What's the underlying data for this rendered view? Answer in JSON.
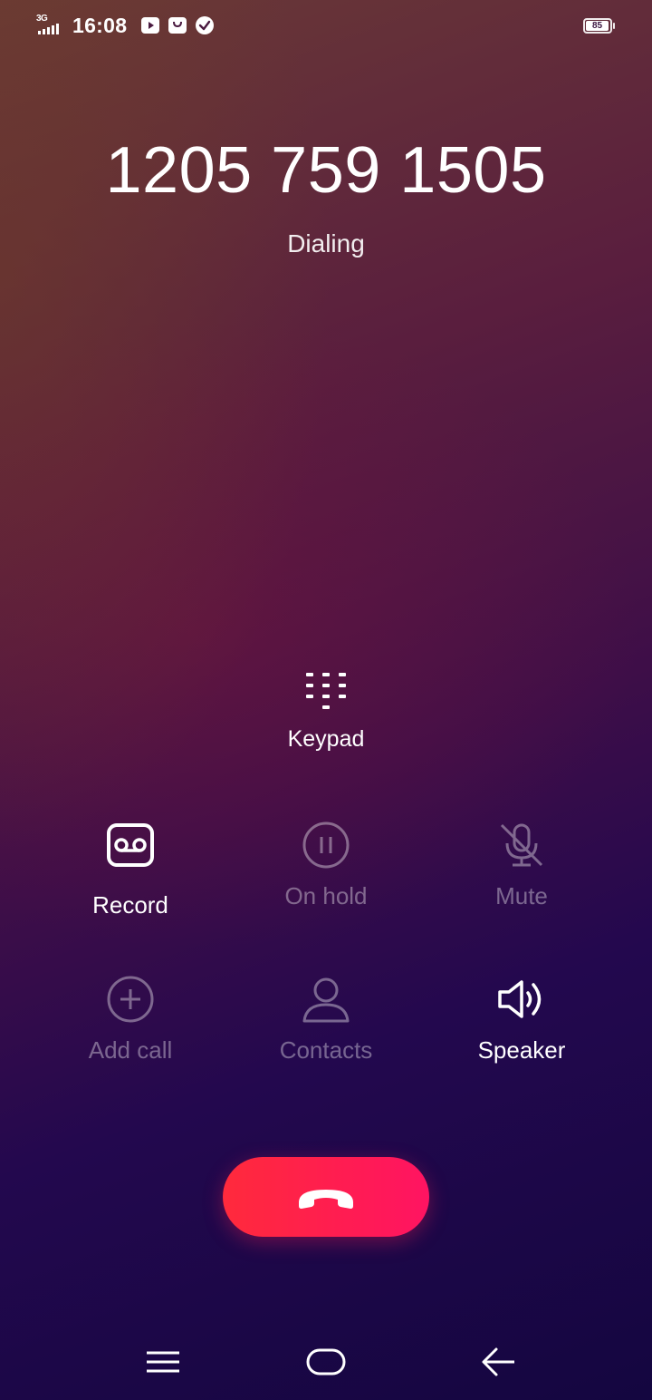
{
  "status_bar": {
    "network_type": "3G",
    "time": "16:08",
    "notification_icons": [
      "youtube-icon",
      "shopping-bag-icon",
      "check-circle-icon"
    ],
    "battery_level": "85"
  },
  "call": {
    "number": "1205 759 1505",
    "status": "Dialing"
  },
  "keypad": {
    "label": "Keypad",
    "icon": "keypad-icon"
  },
  "actions": {
    "record": {
      "label": "Record",
      "icon": "record-icon",
      "enabled": true
    },
    "hold": {
      "label": "On hold",
      "icon": "pause-icon",
      "enabled": false
    },
    "mute": {
      "label": "Mute",
      "icon": "mic-off-icon",
      "enabled": false
    },
    "add_call": {
      "label": "Add call",
      "icon": "plus-circle-icon",
      "enabled": false
    },
    "contacts": {
      "label": "Contacts",
      "icon": "person-icon",
      "enabled": false
    },
    "speaker": {
      "label": "Speaker",
      "icon": "speaker-icon",
      "enabled": true
    }
  },
  "end_call": {
    "icon": "hang-up-icon",
    "color": "#ff1f4f"
  },
  "nav_bar": {
    "items": [
      "menu-icon",
      "home-icon",
      "back-icon"
    ]
  },
  "colors": {
    "text": "#ffffff",
    "disabled_text": "rgba(255,255,255,0.38)",
    "background_top": "#6a3a36",
    "background_bottom": "#140640"
  }
}
